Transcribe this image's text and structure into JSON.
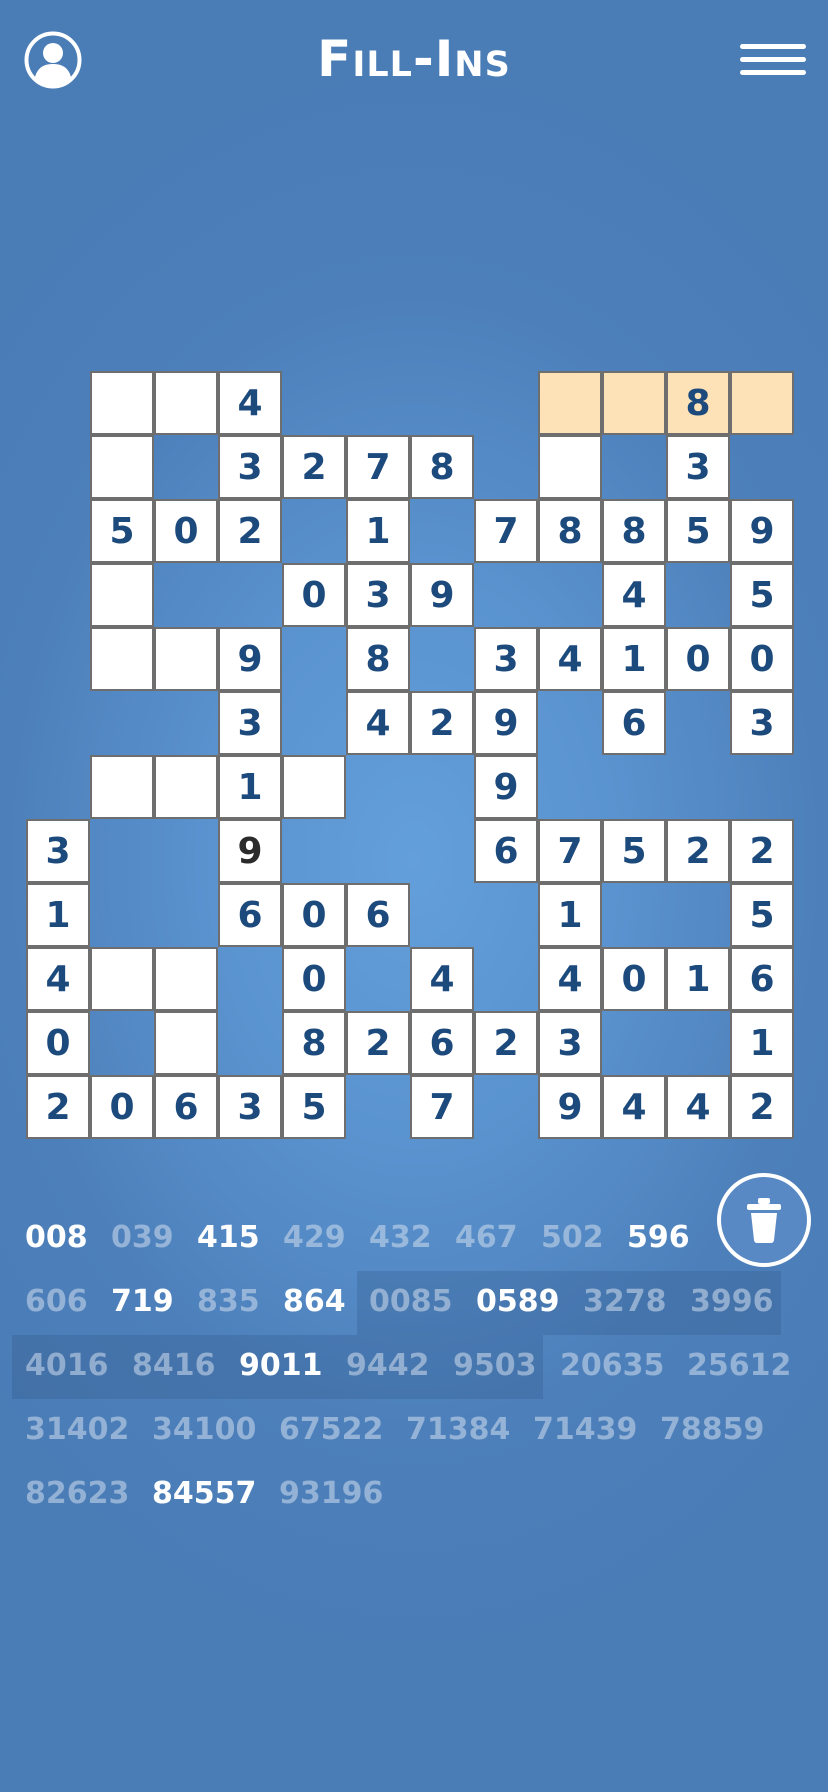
{
  "header": {
    "title": "Fill-Ins",
    "profile_icon": "user-profile-icon",
    "menu_icon": "hamburger-menu-icon"
  },
  "colors": {
    "background": "#5a93cf",
    "cell": "#ffffff",
    "selected_cell": "#fde2b8",
    "digit": "#1d4a7c"
  },
  "board": {
    "rows": [
      {
        "row": 0,
        "cells": [
          [
            1,
            ""
          ],
          [
            2,
            ""
          ],
          [
            3,
            "4"
          ],
          [
            8,
            "",
            "sel"
          ],
          [
            9,
            "",
            "sel"
          ],
          [
            10,
            "8",
            "sel"
          ],
          [
            11,
            "",
            "sel"
          ]
        ]
      },
      {
        "row": 1,
        "cells": [
          [
            1,
            ""
          ],
          [
            3,
            "3"
          ],
          [
            4,
            "2"
          ],
          [
            5,
            "7"
          ],
          [
            6,
            "8"
          ],
          [
            8,
            ""
          ],
          [
            10,
            "3"
          ]
        ]
      },
      {
        "row": 2,
        "cells": [
          [
            1,
            "5"
          ],
          [
            2,
            "0"
          ],
          [
            3,
            "2"
          ],
          [
            5,
            "1"
          ],
          [
            7,
            "7"
          ],
          [
            8,
            "8"
          ],
          [
            9,
            "8"
          ],
          [
            10,
            "5"
          ],
          [
            11,
            "9"
          ]
        ]
      },
      {
        "row": 3,
        "cells": [
          [
            1,
            ""
          ],
          [
            4,
            "0"
          ],
          [
            5,
            "3"
          ],
          [
            6,
            "9"
          ],
          [
            9,
            "4"
          ],
          [
            11,
            "5"
          ]
        ]
      },
      {
        "row": 4,
        "cells": [
          [
            1,
            ""
          ],
          [
            2,
            ""
          ],
          [
            3,
            "9"
          ],
          [
            5,
            "8"
          ],
          [
            7,
            "3"
          ],
          [
            8,
            "4"
          ],
          [
            9,
            "1"
          ],
          [
            10,
            "0"
          ],
          [
            11,
            "0"
          ]
        ]
      },
      {
        "row": 5,
        "cells": [
          [
            3,
            "3"
          ],
          [
            5,
            "4"
          ],
          [
            6,
            "2"
          ],
          [
            7,
            "9"
          ],
          [
            9,
            "6"
          ],
          [
            11,
            "3"
          ]
        ]
      },
      {
        "row": 6,
        "cells": [
          [
            1,
            ""
          ],
          [
            2,
            ""
          ],
          [
            3,
            "1"
          ],
          [
            4,
            ""
          ],
          [
            7,
            "9"
          ]
        ]
      },
      {
        "row": 7,
        "cells": [
          [
            0,
            "3"
          ],
          [
            3,
            "9",
            "dark"
          ],
          [
            7,
            "6"
          ],
          [
            8,
            "7"
          ],
          [
            9,
            "5"
          ],
          [
            10,
            "2"
          ],
          [
            11,
            "2"
          ]
        ]
      },
      {
        "row": 8,
        "cells": [
          [
            0,
            "1"
          ],
          [
            3,
            "6"
          ],
          [
            4,
            "0"
          ],
          [
            5,
            "6"
          ],
          [
            8,
            "1"
          ],
          [
            11,
            "5"
          ]
        ]
      },
      {
        "row": 9,
        "cells": [
          [
            0,
            "4"
          ],
          [
            1,
            ""
          ],
          [
            2,
            ""
          ],
          [
            4,
            "0"
          ],
          [
            6,
            "4"
          ],
          [
            8,
            "4"
          ],
          [
            9,
            "0"
          ],
          [
            10,
            "1"
          ],
          [
            11,
            "6"
          ]
        ]
      },
      {
        "row": 10,
        "cells": [
          [
            0,
            "0"
          ],
          [
            2,
            ""
          ],
          [
            4,
            "8"
          ],
          [
            5,
            "2"
          ],
          [
            6,
            "6"
          ],
          [
            7,
            "2"
          ],
          [
            8,
            "3"
          ],
          [
            11,
            "1"
          ]
        ]
      },
      {
        "row": 11,
        "cells": [
          [
            0,
            "2"
          ],
          [
            1,
            "0"
          ],
          [
            2,
            "6"
          ],
          [
            3,
            "3"
          ],
          [
            4,
            "5"
          ],
          [
            6,
            "7"
          ],
          [
            8,
            "9"
          ],
          [
            9,
            "4"
          ],
          [
            10,
            "4"
          ],
          [
            11,
            "2"
          ]
        ]
      }
    ]
  },
  "trash": {
    "icon": "trash-icon"
  },
  "word_list": [
    {
      "row": 0,
      "words": [
        {
          "text": "008",
          "used": false
        },
        {
          "text": "039",
          "used": true
        },
        {
          "text": "415",
          "used": false
        },
        {
          "text": "429",
          "used": true
        },
        {
          "text": "432",
          "used": true
        },
        {
          "text": "467",
          "used": true
        },
        {
          "text": "502",
          "used": true
        },
        {
          "text": "596",
          "used": false
        }
      ]
    },
    {
      "row": 1,
      "words": [
        {
          "text": "606",
          "used": true
        },
        {
          "text": "719",
          "used": false
        },
        {
          "text": "835",
          "used": true
        },
        {
          "text": "864",
          "used": false
        },
        {
          "text": "0085",
          "used": true
        },
        {
          "text": "0589",
          "used": false
        },
        {
          "text": "3278",
          "used": true
        },
        {
          "text": "3996",
          "used": true
        }
      ]
    },
    {
      "row": 2,
      "words": [
        {
          "text": "4016",
          "used": true
        },
        {
          "text": "8416",
          "used": true
        },
        {
          "text": "9011",
          "used": false
        },
        {
          "text": "9442",
          "used": true
        },
        {
          "text": "9503",
          "used": true
        },
        {
          "text": "20635",
          "used": true
        },
        {
          "text": "25612",
          "used": true
        }
      ]
    },
    {
      "row": 3,
      "words": [
        {
          "text": "31402",
          "used": true
        },
        {
          "text": "34100",
          "used": true
        },
        {
          "text": "67522",
          "used": true
        },
        {
          "text": "71384",
          "used": true
        },
        {
          "text": "71439",
          "used": true
        },
        {
          "text": "78859",
          "used": true
        }
      ]
    },
    {
      "row": 4,
      "words": [
        {
          "text": "82623",
          "used": true
        },
        {
          "text": "84557",
          "used": false
        },
        {
          "text": "93196",
          "used": true
        }
      ]
    }
  ]
}
